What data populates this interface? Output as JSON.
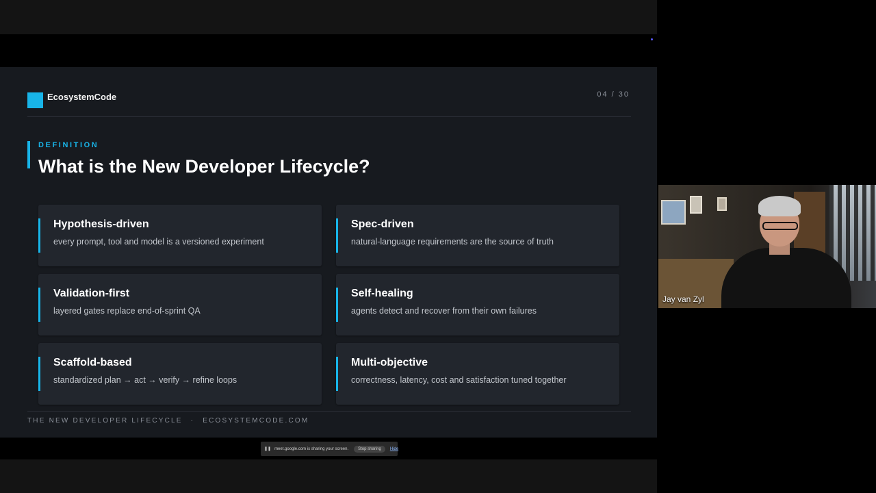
{
  "slide": {
    "brand": "EcosystemCode",
    "page_counter": "04 / 30",
    "eyebrow": "DEFINITION",
    "headline": "What is the New Developer Lifecycle?",
    "cards": [
      {
        "title": "Hypothesis-driven",
        "description": "every prompt, tool and model is a versioned experiment"
      },
      {
        "title": "Spec-driven",
        "description": "natural-language requirements are the source of truth"
      },
      {
        "title": "Validation-first",
        "description": "layered gates replace end-of-sprint QA"
      },
      {
        "title": "Self-healing",
        "description": "agents detect and recover from their own failures"
      },
      {
        "title": "Scaffold-based",
        "description": "standardized plan → act → verify → refine loops"
      },
      {
        "title": "Multi-objective",
        "description": "correctness, latency, cost and satisfaction tuned together"
      }
    ],
    "footer": {
      "left": "THE NEW DEVELOPER LIFECYCLE",
      "separator": "·",
      "right": "ECOSYSTEMCODE.COM"
    },
    "accent_color": "#18b4e8"
  },
  "screen_share_bar": {
    "message": "meet.google.com is sharing your screen.",
    "stop_label": "Stop sharing",
    "hide_label": "Hide"
  },
  "video_tile": {
    "participant_name": "Jay van Zyl"
  }
}
